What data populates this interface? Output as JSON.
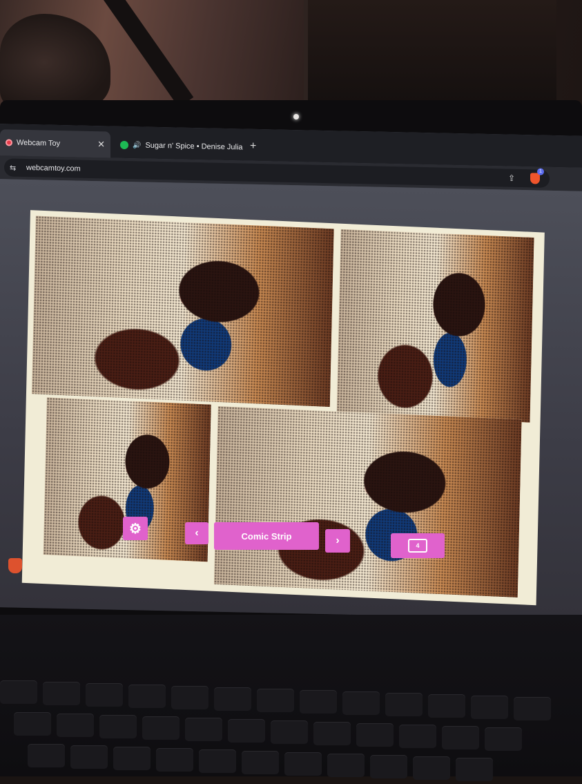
{
  "browser": {
    "tabs": [
      {
        "title": "Webcam Toy",
        "icon": "record-icon",
        "active": true
      },
      {
        "title": "Sugar n' Spice • Denise Julia",
        "icon": "spotify-icon",
        "playing": true
      }
    ],
    "new_tab_symbol": "+",
    "close_symbol": "✕",
    "url": "webcamtoy.com",
    "extension_badge": "1"
  },
  "app": {
    "effect_name": "Comic Strip",
    "photo_count": "4",
    "prev_symbol": "‹",
    "next_symbol": "›",
    "settings_symbol": "⚙"
  },
  "colors": {
    "accent": "#e062cc",
    "card": "#f1ecd6"
  }
}
